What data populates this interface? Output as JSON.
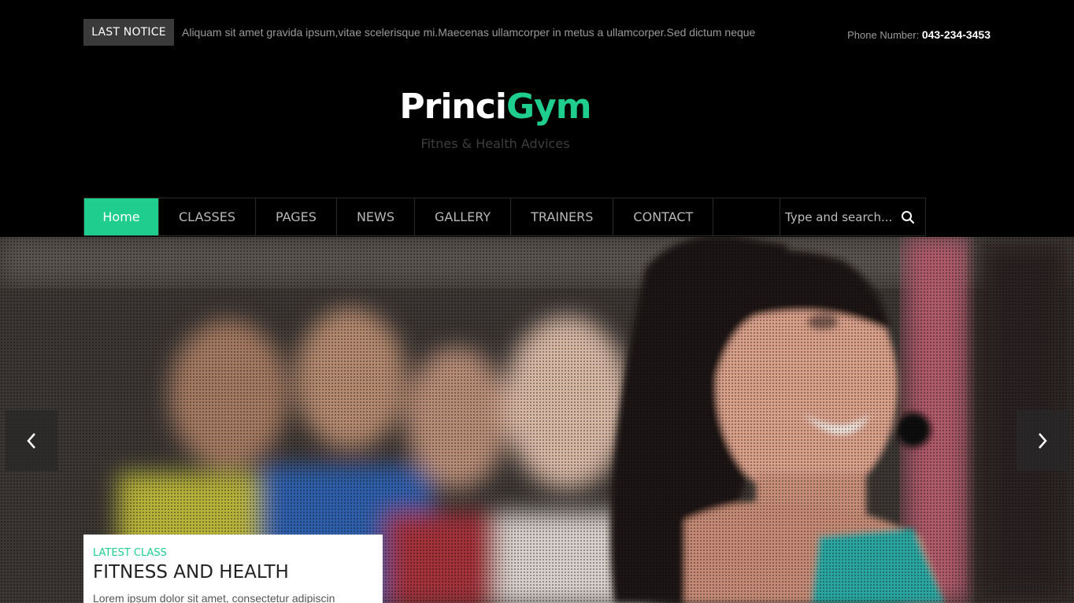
{
  "topbar": {
    "notice_label": "LAST NOTICE",
    "notice_text": "Aliquam sit amet gravida ipsum,vitae scelerisque mi.Maecenas ullamcorper in metus a ullamcorper.Sed dictum neque",
    "phone_label": "Phone Number:",
    "phone_number": "043-234-3453"
  },
  "logo": {
    "part1": "Princi",
    "part2": "Gym",
    "tagline": "Fitnes & Health Advices"
  },
  "nav": {
    "items": [
      {
        "label": "Home",
        "active": true
      },
      {
        "label": "CLASSES"
      },
      {
        "label": "PAGES"
      },
      {
        "label": "NEWS"
      },
      {
        "label": "GALLERY"
      },
      {
        "label": "TRAINERS"
      },
      {
        "label": "CONTACT"
      }
    ],
    "search_placeholder": "Type and search..."
  },
  "hero": {
    "caption_kicker": "LATEST CLASS",
    "caption_title": "FITNESS AND HEALTH",
    "caption_text": "Lorem ipsum dolor sit amet, consectetur adipiscin"
  },
  "colors": {
    "accent": "#1fce8f",
    "background": "#000000"
  },
  "icons": {
    "search": "search-icon",
    "prev": "chevron-left-icon",
    "next": "chevron-right-icon"
  }
}
